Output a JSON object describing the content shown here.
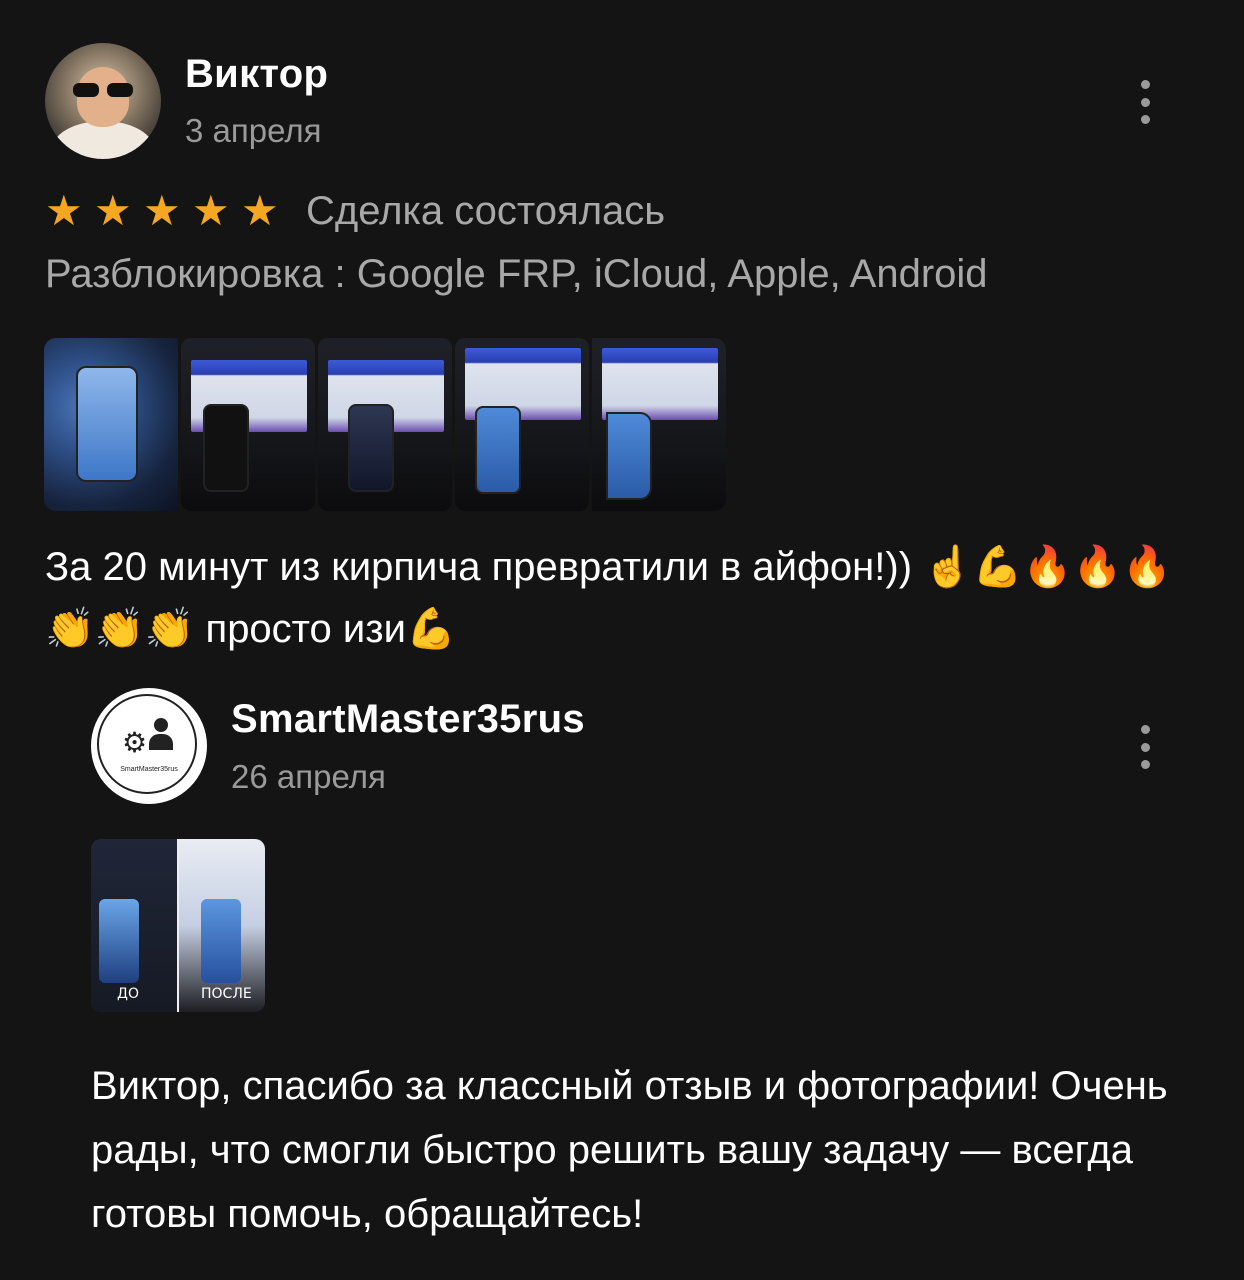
{
  "review": {
    "author": "Виктор",
    "date": "3 апреля",
    "rating": 5,
    "stars": [
      "★",
      "★",
      "★",
      "★",
      "★"
    ],
    "deal_status": "Сделка состоялась",
    "service": "Разблокировка : Google FRP, iCloud, Apple, Android",
    "photo_count": 5,
    "text": "За 20 минут из кирпича превратили в айфон!)) ☝️💪🔥🔥🔥👏👏👏 просто изи💪"
  },
  "reply": {
    "author": "SmartMaster35rus",
    "date": "26 апреля",
    "avatar_caption": "SmartMaster35rus",
    "photo_labels": {
      "before": "ДО",
      "after": "ПОСЛЕ"
    },
    "text": "Виктор, спасибо за классный отзыв и фотографии! Очень рады, что смогли быстро решить вашу задачу — всегда готовы помочь, обращайтесь!"
  },
  "colors": {
    "background": "#141414",
    "star": "#f5a623",
    "secondary_text": "#9a9a9a"
  },
  "icons": {
    "menu": "kebab-vertical-icon",
    "star": "star-icon"
  }
}
